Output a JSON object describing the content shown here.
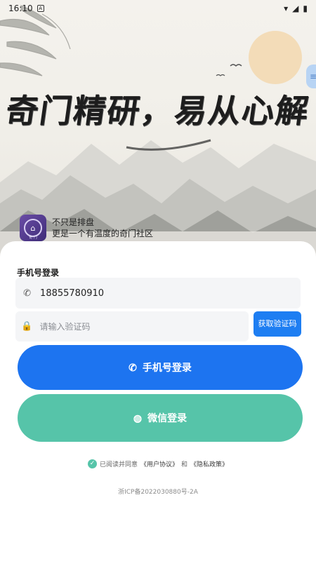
{
  "status_bar": {
    "time": "16:10",
    "notif_icon": "notification-icon",
    "wifi_icon": "wifi-icon",
    "signal_icon": "signal-icon",
    "battery_icon": "battery-icon"
  },
  "hero": {
    "slogan": "奇门精研，易从心解",
    "side_tab_icon": "menu-icon",
    "brand": {
      "tagline": "不只是排盘",
      "subtitle": "更是一个有温度的奇门社区",
      "logo_caption": "奇 门"
    }
  },
  "login": {
    "section_title": "手机号登录",
    "phone_value": "18855780910",
    "code_placeholder": "请输入验证码",
    "get_code_label": "获取验证码",
    "phone_login_label": "手机号登录",
    "wechat_login_label": "微信登录",
    "agreement": {
      "prefix": "已阅读并同意",
      "user_agreement": "《用户协议》",
      "and": "和",
      "privacy_policy": "《隐私政策》"
    },
    "icp": "浙ICP备2022030880号-2A"
  },
  "colors": {
    "primary_blue": "#1d74f0",
    "wechat_green": "#56c4a9",
    "field_bg": "#f4f5f7"
  }
}
